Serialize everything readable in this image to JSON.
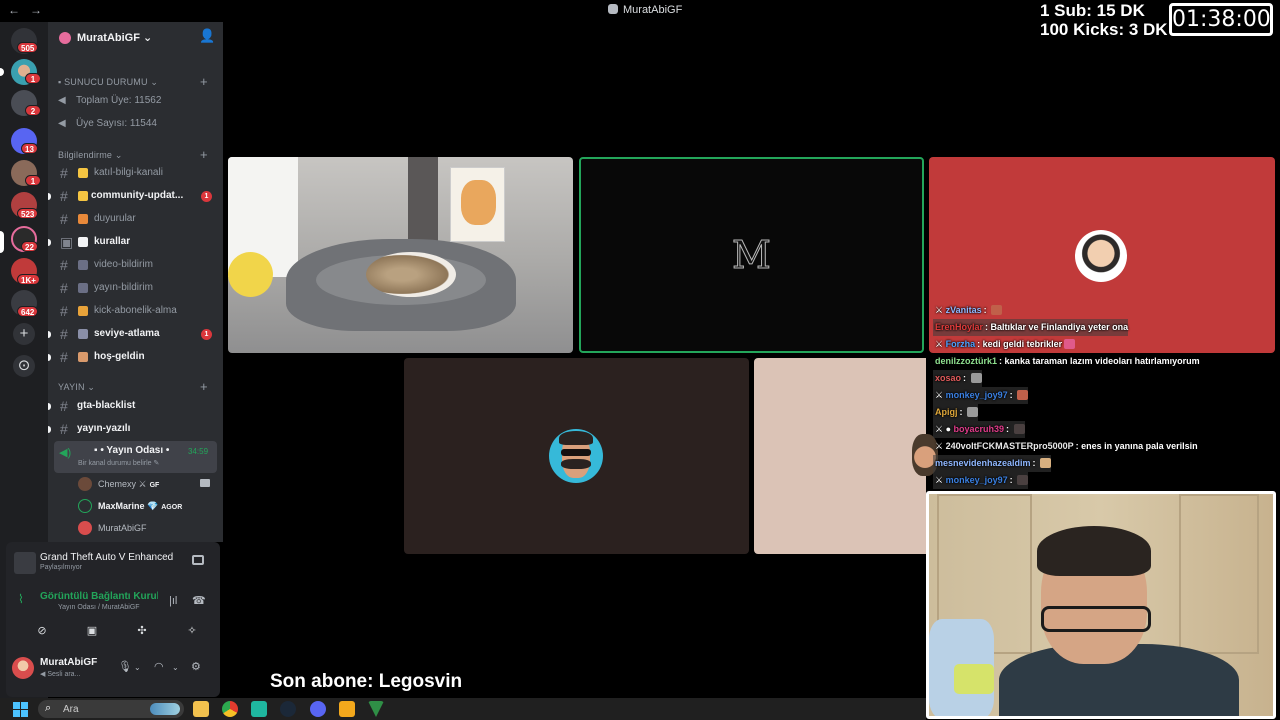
{
  "titlebar": {
    "window_title": "MuratAbiGF",
    "nav_back": "←",
    "nav_forward": "→"
  },
  "overlay": {
    "sub_goal": "1 Sub: 15 DK",
    "kicks_goal": "100 Kicks: 3 DK",
    "timer": "01:38:00",
    "last_sub": "Son abone: Legosvin"
  },
  "rail": {
    "badges": [
      "505",
      "1",
      "2",
      "13",
      "1",
      "523",
      "22",
      "1K+",
      "642"
    ],
    "add_server": "+",
    "explore": "⊙"
  },
  "sidebar": {
    "server_name": "MuratAbiGF",
    "categories": {
      "server_status": "SUNUCU DURUMU",
      "info": "Bilgilendirme",
      "stream": "YAYIN"
    },
    "stats": [
      {
        "label": "Toplam Üye: 11562"
      },
      {
        "label": "Üye Sayısı: 11544"
      }
    ],
    "channels": [
      {
        "label": "katıl-bilgi-kanali",
        "emoji_color": "#f5c542",
        "unread": false
      },
      {
        "label": "community-updat...",
        "emoji_color": "#f5c542",
        "unread": true,
        "mentions": "1"
      },
      {
        "label": "duyurular",
        "emoji_color": "#e8893a",
        "unread": false
      },
      {
        "label": "kurallar",
        "emoji_color": "#f2f3f5",
        "unread": true
      },
      {
        "label": "video-bildirim",
        "emoji_color": "#6b6f85",
        "unread": false
      },
      {
        "label": "yayın-bildirim",
        "emoji_color": "#6b6f85",
        "unread": false
      },
      {
        "label": "kick-abonelik-alma",
        "emoji_color": "#e8a33a",
        "unread": false
      },
      {
        "label": "seviye-atlama",
        "emoji_color": "#8a8fa8",
        "unread": true,
        "mentions": "1"
      },
      {
        "label": "hoş-geldin",
        "emoji_color": "#d99a6c",
        "unread": true
      }
    ],
    "stream_channels": [
      {
        "label": "gta-blacklist"
      },
      {
        "label": "yayın-yazılı"
      }
    ],
    "voice_channel": {
      "name": "Yayın Odası",
      "time": "34:59",
      "subtitle": "Bir kanal durumu belirle"
    },
    "voice_users": [
      {
        "name": "Chemexy",
        "tag": "GF",
        "avatar_color": "#6b4a3a"
      },
      {
        "name": "MaxMarine",
        "tag": "AGOR",
        "avatar_color": "#2b2d31"
      },
      {
        "name": "MuratAbiGF",
        "tag": "",
        "avatar_color": "#d94d4d"
      }
    ]
  },
  "activity": {
    "game_title": "Grand Theft Auto V Enhanced",
    "game_status": "Paylaşılmıyor",
    "rtc_title": "Görüntülü Bağlantı Kuruldu",
    "rtc_sub": "Yayın Odası / MuratAbiGF"
  },
  "user": {
    "name": "MuratAbiGF",
    "status": "Sesli ara..."
  },
  "chat": [
    {
      "user": "zVanitas",
      "text": "",
      "user_color": "#8fb7ff",
      "emote_color": "#c0604a"
    },
    {
      "user": "ErenHoylar",
      "text": "Baltıklar ve Finlandiya yeter ona",
      "user_color": "#e03b3b",
      "emote_color": ""
    },
    {
      "user": "Forzha",
      "text": "kedi geldi tebrikler",
      "user_color": "#4aa0ff",
      "emote_color": "#e05a8a"
    },
    {
      "user": "denilzzoztürk1",
      "text": "kanka taraman lazım videoları hatırlamıyorum",
      "user_color": "#8fe08f",
      "emote_color": ""
    },
    {
      "user": "xosao",
      "text": "",
      "user_color": "#e05a5a",
      "emote_color": "#9a9a9a"
    },
    {
      "user": "monkey_joy97",
      "text": "",
      "user_color": "#3a7fe0",
      "emote_color": "#c0604a"
    },
    {
      "user": "Apigj",
      "text": "",
      "user_color": "#e0a83a",
      "emote_color": "#9a9a9a"
    },
    {
      "user": "boyacruh39",
      "text": "",
      "user_color": "#e03b8a",
      "emote_color": "#4a4040"
    },
    {
      "user": "240voltFCKMASTERpro5000P",
      "text": "enes in yanına pala verilsin",
      "user_color": "#e8e8e8",
      "emote_color": ""
    },
    {
      "user": "mesnevidenhazealdim",
      "text": "",
      "user_color": "#8fb7ff",
      "emote_color": "#d8b080"
    },
    {
      "user": "monkey_joy97",
      "text": "",
      "user_color": "#3a7fe0",
      "emote_color": "#4a4040"
    }
  ],
  "tiles": {
    "m_logo": "M"
  },
  "taskbar": {
    "search_placeholder": "Ara"
  }
}
